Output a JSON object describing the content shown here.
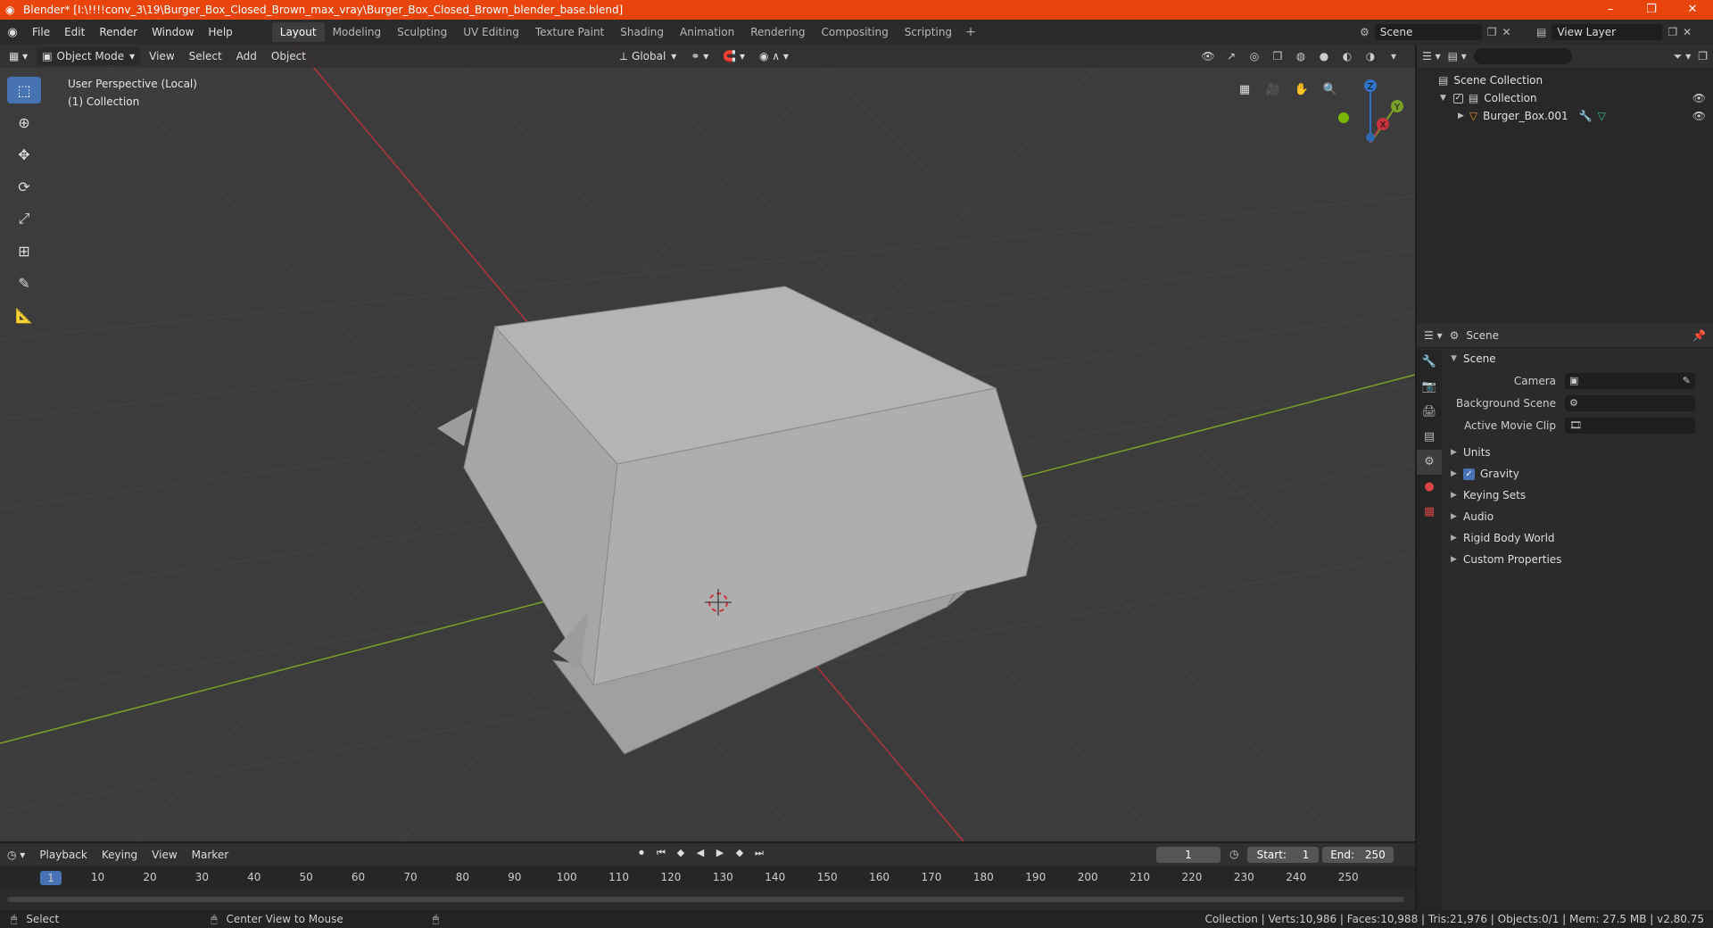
{
  "window": {
    "title": "Blender* [I:\\!!!!conv_3\\19\\Burger_Box_Closed_Brown_max_vray\\Burger_Box_Closed_Brown_blender_base.blend]",
    "minimize": "–",
    "maximize": "❐",
    "close": "✕"
  },
  "menubar": {
    "menus": [
      "File",
      "Edit",
      "Render",
      "Window",
      "Help"
    ],
    "workspaces": [
      "Layout",
      "Modeling",
      "Sculpting",
      "UV Editing",
      "Texture Paint",
      "Shading",
      "Animation",
      "Rendering",
      "Compositing",
      "Scripting"
    ],
    "active_workspace": "Layout",
    "add_workspace": "+",
    "scene": "Scene",
    "view_layer": "View Layer"
  },
  "viewport": {
    "mode": "Object Mode",
    "menus": [
      "View",
      "Select",
      "Add",
      "Object"
    ],
    "orientation": "Global",
    "perspective_label": "User Perspective (Local)",
    "collection_label": "(1) Collection",
    "gizmo": {
      "z": "Z",
      "y": "Y",
      "x": "X"
    },
    "colors": {
      "background": "#3c3c3c",
      "x_axis": "#b0343c",
      "y_axis": "#7ba02a",
      "object": "#a8a8a8"
    }
  },
  "outliner": {
    "scene_collection": "Scene Collection",
    "collection": "Collection",
    "object": "Burger_Box.001",
    "search_placeholder": ""
  },
  "properties": {
    "context": "Scene",
    "panel": "Scene",
    "camera_label": "Camera",
    "background_scene_label": "Background Scene",
    "active_movie_clip_label": "Active Movie Clip",
    "subpanels": [
      "Units",
      "Gravity",
      "Keying Sets",
      "Audio",
      "Rigid Body World",
      "Custom Properties"
    ],
    "gravity_checked": true
  },
  "timeline": {
    "menus": [
      "Playback",
      "Keying",
      "View",
      "Marker"
    ],
    "current_frame": "1",
    "start_label": "Start:",
    "start": "1",
    "end_label": "End:",
    "end": "250",
    "ruler_ticks": [
      "10",
      "20",
      "30",
      "40",
      "50",
      "60",
      "70",
      "80",
      "90",
      "100",
      "110",
      "120",
      "130",
      "140",
      "150",
      "160",
      "170",
      "180",
      "190",
      "200",
      "210",
      "220",
      "230",
      "240",
      "250"
    ],
    "playhead": "1"
  },
  "statusbar": {
    "select": "Select",
    "center_view": "Center View to Mouse",
    "stats": "Collection | Verts:10,986 | Faces:10,988 | Tris:21,976 | Objects:0/1 | Mem: 27.5 MB | v2.80.75"
  }
}
